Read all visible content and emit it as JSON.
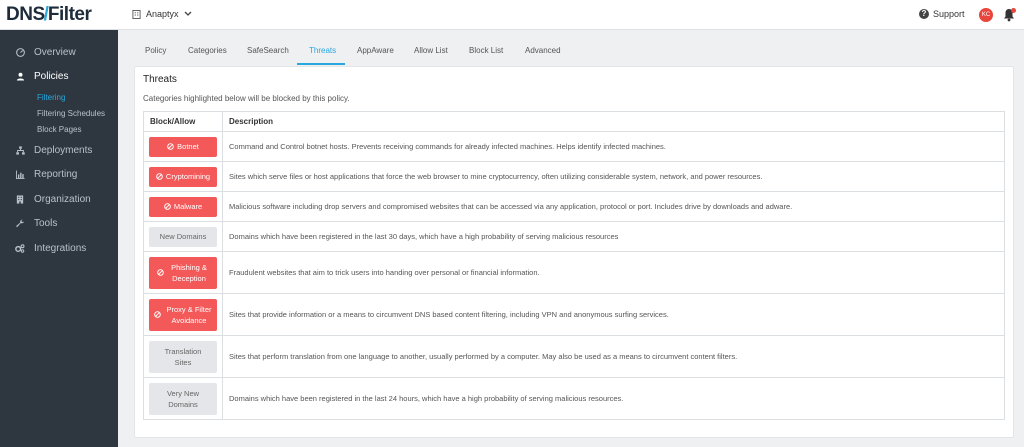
{
  "brand": {
    "logo_left": "DNS",
    "logo_right": "Filter"
  },
  "header": {
    "org_name": "Anaptyx",
    "support_label": "Support",
    "avatar_initials": "KC"
  },
  "sidebar": {
    "items": [
      {
        "label": "Overview",
        "icon": "overview-icon"
      },
      {
        "label": "Policies",
        "icon": "user-icon"
      },
      {
        "label": "Deployments",
        "icon": "sitemap-icon"
      },
      {
        "label": "Reporting",
        "icon": "bar-chart-icon"
      },
      {
        "label": "Organization",
        "icon": "building-icon"
      },
      {
        "label": "Tools",
        "icon": "wrench-icon"
      },
      {
        "label": "Integrations",
        "icon": "cogs-icon"
      }
    ],
    "sub_items": [
      "Filtering",
      "Filtering Schedules",
      "Block Pages"
    ],
    "active_sub": "Filtering"
  },
  "tabs": [
    "Policy",
    "Categories",
    "SafeSearch",
    "Threats",
    "AppAware",
    "Allow List",
    "Block List",
    "Advanced"
  ],
  "active_tab": "Threats",
  "panel": {
    "title": "Threats",
    "subtitle": "Categories highlighted below will be blocked by this policy.",
    "col_block": "Block/Allow",
    "col_desc": "Description",
    "rows": [
      {
        "name": "Botnet",
        "state": "blocked",
        "desc": "Command and Control botnet hosts. Prevents receiving commands for already infected machines. Helps identify infected machines."
      },
      {
        "name": "Cryptomining",
        "state": "blocked",
        "desc": "Sites which serve files or host applications that force the web browser to mine cryptocurrency, often utilizing considerable system, network, and power resources."
      },
      {
        "name": "Malware",
        "state": "blocked",
        "desc": "Malicious software including drop servers and compromised websites that can be accessed via any application, protocol or port. Includes drive by downloads and adware."
      },
      {
        "name": "New Domains",
        "state": "allowed",
        "desc": "Domains which have been registered in the last 30 days, which have a high probability of serving malicious resources"
      },
      {
        "name": "Phishing & Deception",
        "state": "blocked",
        "desc": "Fraudulent websites that aim to trick users into handing over personal or financial information."
      },
      {
        "name": "Proxy & Filter Avoidance",
        "state": "blocked",
        "desc": "Sites that provide information or a means to circumvent DNS based content filtering, including VPN and anonymous surfing services."
      },
      {
        "name": "Translation Sites",
        "state": "allowed",
        "desc": "Sites that perform translation from one language to another, usually performed by a computer. May also be used as a means to circumvent content filters."
      },
      {
        "name": "Very New Domains",
        "state": "allowed",
        "desc": "Domains which have been registered in the last 24 hours, which have a high probability of serving malicious resources."
      }
    ]
  },
  "colors": {
    "accent": "#2aa7df",
    "block": "#f4595a",
    "allow": "#e4e6e9",
    "sidebar": "#2e3740"
  }
}
